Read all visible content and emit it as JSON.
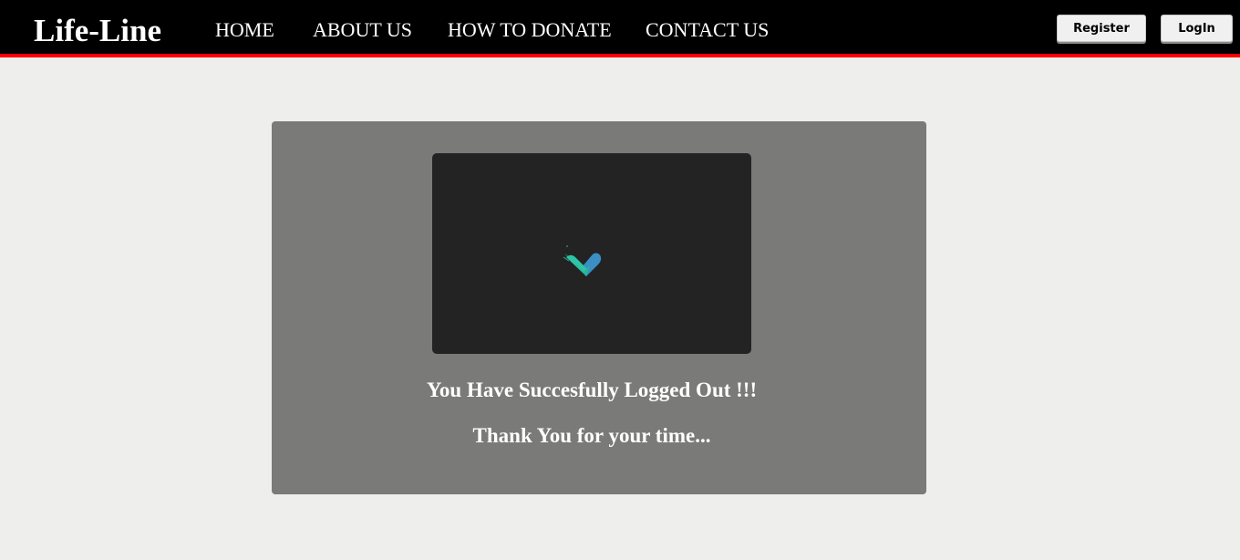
{
  "header": {
    "brand": "Life-Line",
    "nav": [
      {
        "label": "HOME"
      },
      {
        "label": "ABOUT US"
      },
      {
        "label": "HOW TO DONATE"
      },
      {
        "label": "CONTACT US"
      }
    ],
    "register_label": "Register",
    "login_label": "LogIn"
  },
  "main": {
    "media_icon": "heart-check-icon",
    "message": "You Have Succesfully Logged Out !!!",
    "submessage": "Thank You for your time..."
  },
  "colors": {
    "nav_background": "#000000",
    "nav_border": "#ff0000",
    "page_background": "#eeeeec",
    "card_background": "#7a7a78",
    "media_background": "#232323",
    "icon_teal": "#2ec4a6",
    "icon_blue": "#3a8fc4"
  }
}
